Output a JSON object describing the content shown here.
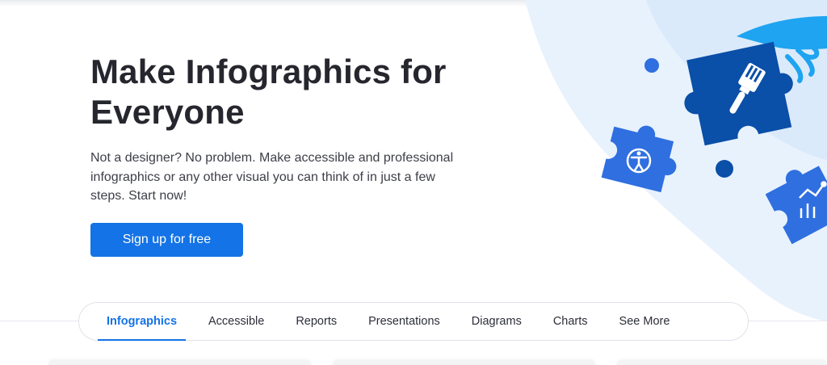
{
  "hero": {
    "title": "Make Infographics for Everyone",
    "description": "Not a designer? No problem. Make accessible and professional infographics or any other visual you can think of in just a few steps. Start now!",
    "cta_label": "Sign up for free"
  },
  "tabs": [
    {
      "label": "Infographics",
      "active": true
    },
    {
      "label": "Accessible",
      "active": false
    },
    {
      "label": "Reports",
      "active": false
    },
    {
      "label": "Presentations",
      "active": false
    },
    {
      "label": "Diagrams",
      "active": false
    },
    {
      "label": "Charts",
      "active": false
    },
    {
      "label": "See More",
      "active": false
    }
  ],
  "colors": {
    "accent": "#1473e6",
    "puzzle_dark": "#0a4fa8",
    "puzzle_mid": "#2f6fe0",
    "hand": "#1ea4f0",
    "bg_shape": "#e8f2fd"
  },
  "icons": [
    "paintbrush-icon",
    "accessibility-icon",
    "chart-icon"
  ]
}
